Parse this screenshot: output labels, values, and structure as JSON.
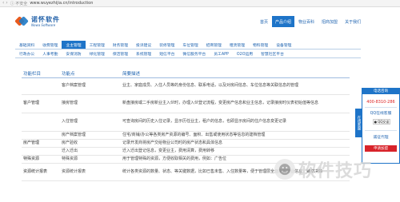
{
  "browser": {
    "nav_glyph": "‹ ›",
    "security": "ⓘ 不安全",
    "url": "www.wuyezhijia.cn/introduction"
  },
  "logo": {
    "cn": "诺怀软件",
    "en": "Nowa Software"
  },
  "topnav": [
    {
      "label": "首页",
      "active": false
    },
    {
      "label": "产品介绍",
      "active": true
    },
    {
      "label": "物业百科",
      "active": false
    },
    {
      "label": "招商加盟",
      "active": false
    },
    {
      "label": "关于我们",
      "active": false
    }
  ],
  "categories_row1": [
    {
      "label": "基础资料",
      "active": false
    },
    {
      "label": "收费管理",
      "active": false
    },
    {
      "label": "业主管理",
      "active": true
    },
    {
      "label": "工程管理",
      "active": false
    },
    {
      "label": "财务管理",
      "active": false
    },
    {
      "label": "投诉建议",
      "active": false
    },
    {
      "label": "装修管理",
      "active": false
    },
    {
      "label": "车位管理",
      "active": false
    },
    {
      "label": "招商管理",
      "active": false
    },
    {
      "label": "租赁管理",
      "active": false
    },
    {
      "label": "物料管理",
      "active": false
    },
    {
      "label": "设备管理",
      "active": false
    }
  ],
  "categories_row2": [
    {
      "label": "行政办公",
      "active": false
    },
    {
      "label": "人事考勤",
      "active": false
    },
    {
      "label": "安保消防",
      "active": false
    },
    {
      "label": "绿化管理",
      "active": false
    },
    {
      "label": "保洁管理",
      "active": false
    },
    {
      "label": "系统管理",
      "active": false
    },
    {
      "label": "短信平台",
      "active": false
    },
    {
      "label": "微信服务平台",
      "active": false
    },
    {
      "label": "员工APP",
      "active": false
    },
    {
      "label": "O2O运用",
      "active": false
    },
    {
      "label": "智慧社区平台",
      "active": false
    }
  ],
  "table": {
    "headers": [
      "功能栏目",
      "功能点",
      "简要描述"
    ],
    "rows": [
      {
        "category": "",
        "feature": "客户档案管理",
        "desc": "业主、家庭成员、入住人员等的身份信息、联系电话，以及对房间信息、车位信息等关联信息的管理"
      },
      {
        "category": "客户管理",
        "feature": "接房管理",
        "desc": "新盘接房或二手房新业主入伙时，办理入伙登记流程，变更房产信息和业主信息，记录接房时仪表初始值等信息"
      },
      {
        "category": "",
        "feature": "入住管理",
        "desc": "可查询房间的历史入住记录，显示历任业主，租户的信息，也即显示房间的住户信息变更记录"
      },
      {
        "category": "",
        "feature": "房产档案管理",
        "desc": "住宅/商铺/办公等各类房产资源的编号、面积、出售或使用状态等信息的建档管理"
      },
      {
        "category": "房产管理",
        "feature": "房产验收",
        "desc": "记录开发商将房产交给物业公司时的房产状态和具体信息"
      },
      {
        "category": "",
        "feature": "迁入迁出",
        "desc": "迁入迁出登记信息，变更业主，费用清算，费用转移"
      },
      {
        "category": "特殊资源",
        "feature": "特殊资源",
        "desc": "用于管理特殊的资源，方便收取相关的费用，例如：广告位"
      },
      {
        "category": "资源统计报表",
        "feature": "资源统计报表",
        "desc": "统计各类资源的数量、状态、等关键数据，比如已售未售、入住数量等，便于管理层全面掌握物业信息，辅助决策"
      }
    ]
  },
  "side_panel": {
    "header": "电话咨询",
    "phone": "400-8310-286",
    "qq_label": "QQ在线客服",
    "qq_button": "QQ交谈",
    "wx_label": "诚征代理",
    "apply_button": "申请加盟",
    "tab": "在线客服"
  },
  "watermark": {
    "text": "软件技巧"
  }
}
